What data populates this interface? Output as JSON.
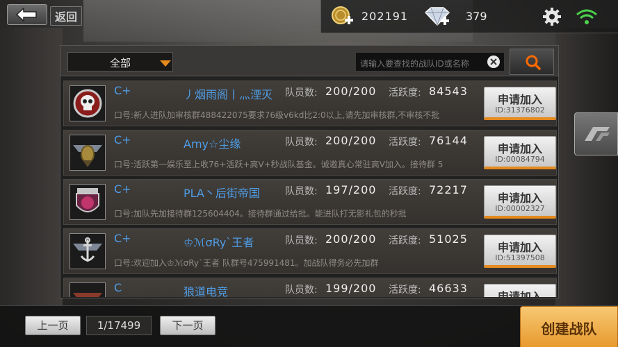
{
  "header": {
    "back_label": "返回",
    "coins": "202191",
    "gems": "379"
  },
  "filter": {
    "selected": "全部",
    "search_placeholder": "请输入要查找的战队ID或名称"
  },
  "rows": [
    {
      "rank": "C+",
      "name": "丿烟雨阁丨灬湮灭",
      "member_label": "队员数:",
      "members": "200/200",
      "activity_label": "活跃度:",
      "activity": "84543",
      "slogan": "口号:新人进队加审核群488422075要求76级v6kd比2:0以上,请先加审核群,不审核不批",
      "join_label": "申请加入",
      "id": "ID:31376802",
      "emblem": "skull-emblem-icon"
    },
    {
      "rank": "C+",
      "name": "Amy☆尘缘",
      "member_label": "队员数:",
      "members": "200/200",
      "activity_label": "活跃度:",
      "activity": "76144",
      "slogan": "口号:活跃第一娱乐至上收76+活跃+高V+秒战队基金。诚邀真心常驻高V加入。接待群 5",
      "join_label": "申请加入",
      "id": "ID:00084794",
      "emblem": "grenade-emblem-icon"
    },
    {
      "rank": "C+",
      "name": "PLA丶后街帝国",
      "member_label": "队员数:",
      "members": "197/200",
      "activity_label": "活跃度:",
      "activity": "72217",
      "slogan": "口号:加队先加接待群125604404。接待群通过给批。能进队打无影礼包的秒批",
      "join_label": "申请加入",
      "id": "ID:00002327",
      "emblem": "shield-emblem-icon"
    },
    {
      "rank": "C+",
      "name": "♔ℳσRy`王者",
      "member_label": "队员数:",
      "members": "200/200",
      "activity_label": "活跃度:",
      "activity": "51025",
      "slogan": "口号:欢迎加入♔ℳσRy`王者 队群号475991481。加战队得务必先加群",
      "join_label": "申请加入",
      "id": "ID:51397508",
      "emblem": "anchor-emblem-icon"
    },
    {
      "rank": "C",
      "name": "狼道电竞",
      "member_label": "队员数:",
      "members": "199/200",
      "activity_label": "活跃度:",
      "activity": "46633",
      "slogan": "",
      "join_label": "申请加入",
      "id": "",
      "emblem": "wing-emblem-icon"
    }
  ],
  "pagination": {
    "prev_label": "上一页",
    "page": "1/17499",
    "next_label": "下一页"
  },
  "create_label": "创建战队"
}
